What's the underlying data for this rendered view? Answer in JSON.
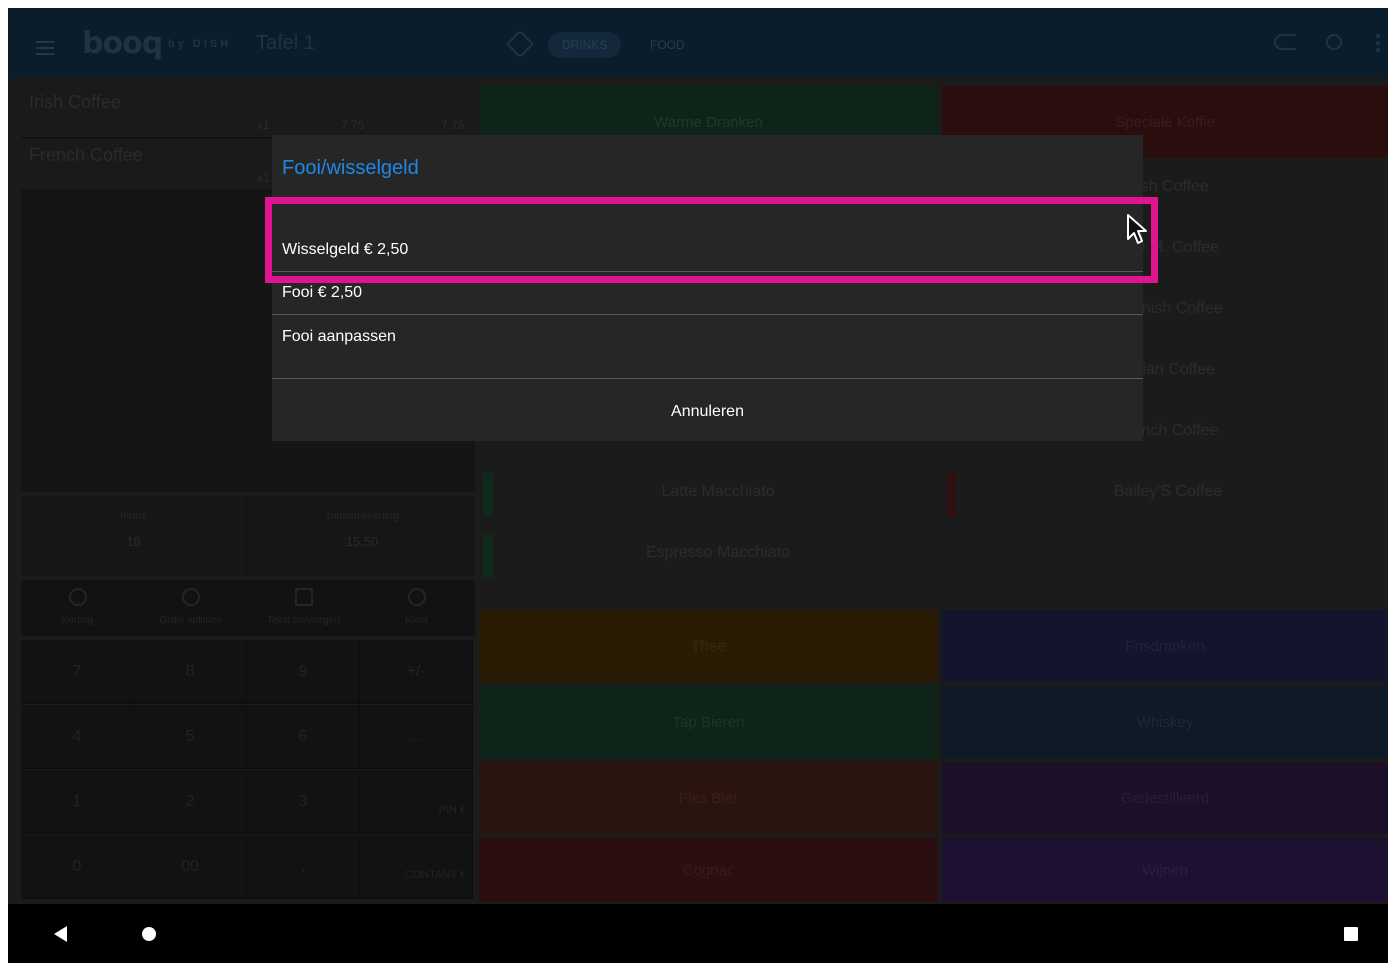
{
  "topbar": {
    "logo": "booq",
    "logo_sub": "by DISH",
    "table_title": "Tafel 1",
    "tabs": [
      {
        "label": "DRINKS",
        "active": true
      },
      {
        "label": "FOOD",
        "active": false
      }
    ]
  },
  "order": {
    "items": [
      {
        "name": "Irish Coffee",
        "qty": "x1",
        "price": "7,75",
        "total": "7,75"
      },
      {
        "name": "French Coffee",
        "qty": "x1",
        "price": "",
        "total": ""
      }
    ],
    "totals": {
      "persons_label": "Items",
      "persons_value": "18",
      "sum_label": "Tafelafrekening",
      "sum_value": "15,50"
    }
  },
  "actions": [
    {
      "label": "Korting",
      "icon": "discount-icon"
    },
    {
      "label": "Order splitsen",
      "icon": "split-icon"
    },
    {
      "label": "Tekst toevoegen",
      "icon": "comment-icon"
    },
    {
      "label": "Klant",
      "icon": "person-icon"
    }
  ],
  "keypad": {
    "keys": [
      "7",
      "8",
      "9",
      "+/-",
      "4",
      "5",
      "6",
      "...",
      "1",
      "2",
      "3",
      "0",
      "00",
      ","
    ],
    "pin_label": "PIN €",
    "cash_label": "CONTANT €"
  },
  "products": {
    "categories_top": [
      "Warme Dranken",
      "Speciale Koffie"
    ],
    "left_items": [
      "Latte Macchiato",
      "Espresso Macchiato"
    ],
    "right_items": [
      "Irish Coffee",
      "D.O.M. Coffee",
      "Spanish Coffee",
      "Italian Coffee",
      "French Coffee",
      "Bailey'S Coffee"
    ],
    "categories_bottom": [
      [
        "Thee",
        "Frisdranken"
      ],
      [
        "Tap Bieren",
        "Whiskey"
      ],
      [
        "Fles Bier",
        "Gedestilleerd"
      ],
      [
        "Cognac",
        "Wijnen"
      ]
    ]
  },
  "dialog": {
    "title": "Fooi/wisselgeld",
    "options": [
      "Wisselgeld € 2,50",
      "Fooi € 2,50",
      "Fooi aanpassen"
    ],
    "cancel": "Annuleren"
  },
  "colors": {
    "dialog_title": "#1e88e5",
    "highlight": "#e0148e",
    "topbar": "#0b1c2b"
  }
}
